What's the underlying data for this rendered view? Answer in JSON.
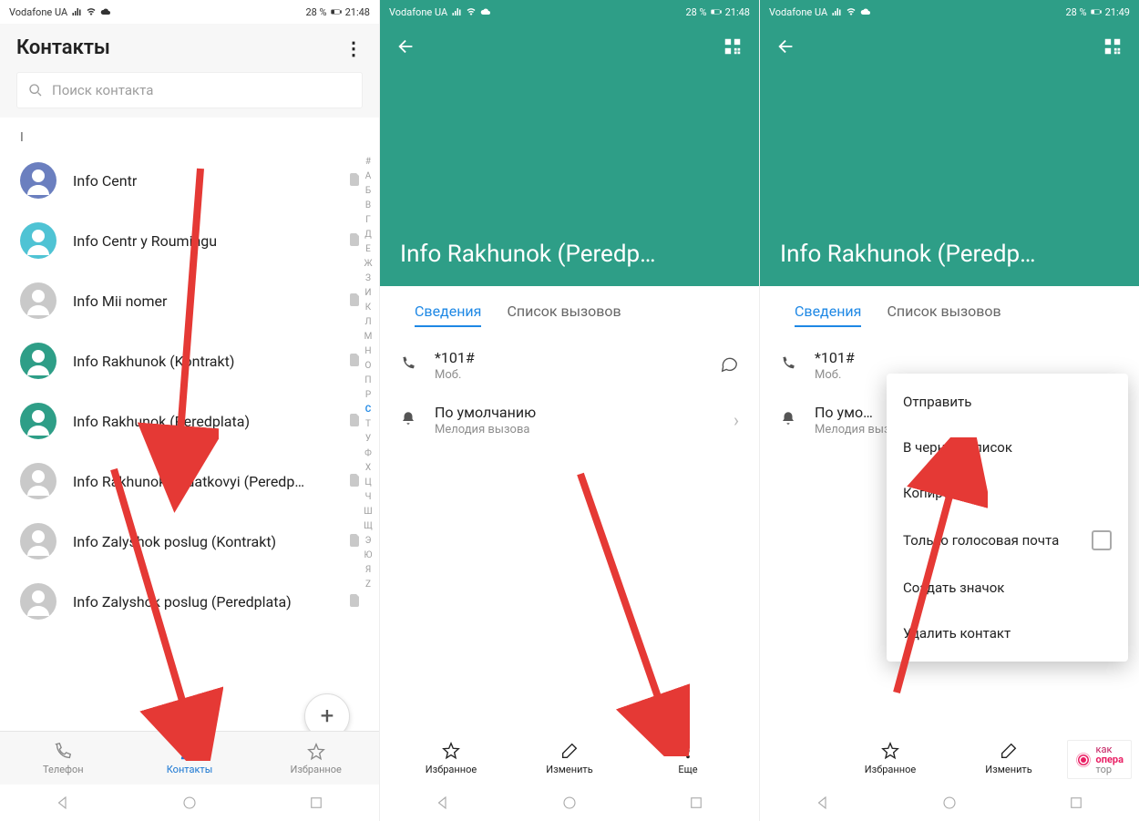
{
  "status": {
    "carrier": "Vodafone UA",
    "battery": "28 %",
    "time_a": "21:48",
    "time_b": "21:49"
  },
  "screen1": {
    "title": "Контакты",
    "search_placeholder": "Поиск контакта",
    "section": "I",
    "contacts": [
      {
        "name": "Info Centr",
        "color": "#6b7fbf"
      },
      {
        "name": "Info Centr y Roumingu",
        "color": "#4fc3d4"
      },
      {
        "name": "Info Mii nomer",
        "color": "#c9c9c9"
      },
      {
        "name": "Info Rakhunok (Kontrakt)",
        "color": "#2e9e87"
      },
      {
        "name": "Info Rakhunok (Peredplata)",
        "color": "#2e9e87"
      },
      {
        "name": "Info Rakhunok dodatkovyi (Peredp…",
        "color": "#c9c9c9"
      },
      {
        "name": "Info Zalyshok poslug (Kontrakt)",
        "color": "#c9c9c9"
      },
      {
        "name": "Info Zalyshok poslug (Peredplata)",
        "color": "#c9c9c9"
      }
    ],
    "index": [
      "#",
      "А",
      "Б",
      "В",
      "Г",
      "Д",
      "Е",
      "Ж",
      "З",
      "И",
      "К",
      "Л",
      "М",
      "Н",
      "О",
      "П",
      "Р",
      "С",
      "Т",
      "У",
      "Ф",
      "Х",
      "Ц",
      "Ч",
      "Ш",
      "Щ",
      "Э",
      "Ю",
      "Я",
      "Z"
    ],
    "index_hl": "С",
    "nav": {
      "phone": "Телефон",
      "contacts": "Контакты",
      "fav": "Избранное"
    }
  },
  "detail": {
    "title": "Info Rakhunok (Peredp…",
    "tab_details": "Сведения",
    "tab_calls": "Список вызовов",
    "number": "*101#",
    "number_type": "Моб.",
    "ringtone": "По умолчанию",
    "ringtone_sub": "Мелодия вызова",
    "actions": {
      "fav": "Избранное",
      "edit": "Изменить",
      "more": "Еще"
    }
  },
  "detail2": {
    "ringtone": "По умо…",
    "menu": [
      "Отправить",
      "В черный список",
      "Копировать",
      "Только голосовая почта",
      "Создать значок",
      "Удалить контакт"
    ]
  },
  "watermark": {
    "t1": "как",
    "t2": "опера",
    "t3": "тор"
  }
}
